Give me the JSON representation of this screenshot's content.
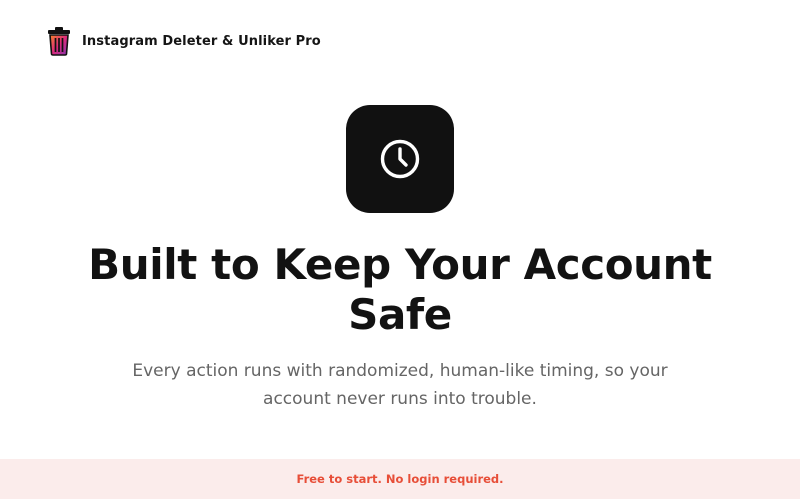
{
  "header": {
    "logo_icon": "trash-can-icon",
    "app_name": "Instagram Deleter & Unliker Pro"
  },
  "hero": {
    "icon": "clock-icon",
    "title": "Built to Keep Your Account Safe",
    "description": "Every action runs with randomized, human-like timing, so your account never runs into trouble."
  },
  "promo_bar": {
    "text": "Free to start. No login required."
  },
  "colors": {
    "logo_gradient_start": "#f58529",
    "logo_gradient_mid": "#dd2a7b",
    "logo_gradient_end": "#8134af",
    "hero_icon_bg": "#111111",
    "promo_bg": "#fbeceb",
    "promo_text": "#e74e38",
    "body_text": "#656565"
  }
}
